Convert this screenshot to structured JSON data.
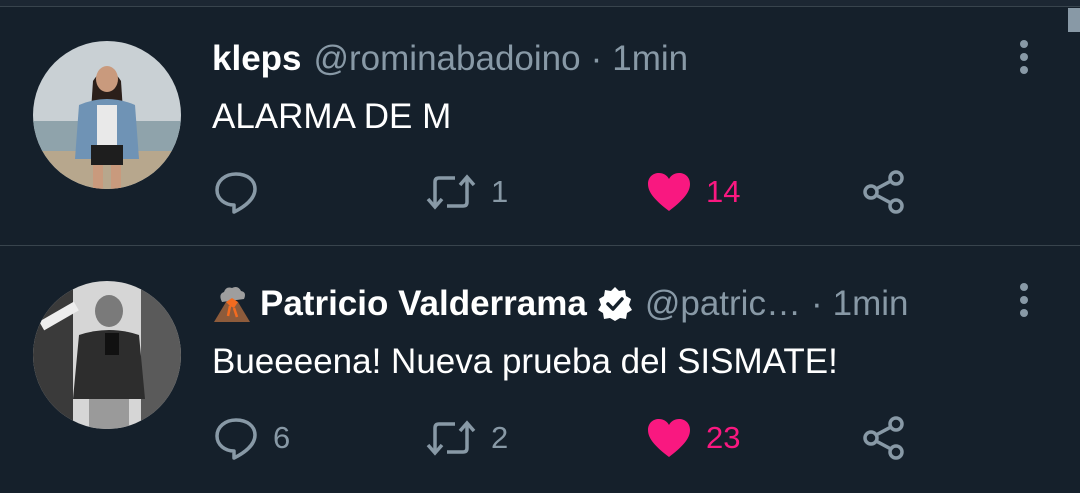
{
  "tweets": [
    {
      "display_name": "kleps",
      "handle": "@rominabadoino",
      "separator": "·",
      "time": "1min",
      "text": "ALARMA DE M",
      "reply_count": "",
      "retweet_count": "1",
      "like_count": "14",
      "liked": true,
      "verified": false,
      "name_emoji": ""
    },
    {
      "display_name": "Patricio Valderrama",
      "handle": "@patric…",
      "separator": "·",
      "time": "1min",
      "text": "Bueeeena! Nueva prueba del SISMATE!",
      "reply_count": "6",
      "retweet_count": "2",
      "like_count": "23",
      "liked": true,
      "verified": true,
      "name_emoji": "volcano-icon"
    }
  ],
  "colors": {
    "background": "#15202b",
    "divider": "#38444d",
    "secondary_text": "#8899a6",
    "like_pink": "#f91880",
    "primary_text": "#ffffff"
  }
}
